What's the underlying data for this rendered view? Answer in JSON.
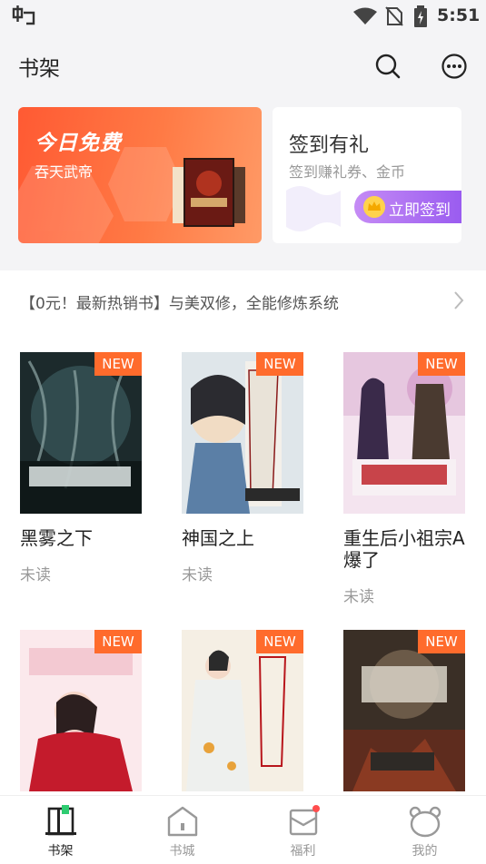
{
  "status_bar": {
    "time": "5:51"
  },
  "header": {
    "title": "书架"
  },
  "promo_free": {
    "label": "今日免费",
    "book": "吞天武帝"
  },
  "promo_sign": {
    "title": "签到有礼",
    "subtitle": "签到赚礼券、金币",
    "button": "立即签到"
  },
  "banner": {
    "text": "【0元！最新热销书】与美双修，全能修炼系统"
  },
  "books": [
    {
      "title": "黑雾之下",
      "status": "未读",
      "badge": "NEW"
    },
    {
      "title": "神国之上",
      "status": "未读",
      "badge": "NEW"
    },
    {
      "title": "重生后小祖宗A爆了",
      "status": "未读",
      "badge": "NEW"
    },
    {
      "title": "",
      "status": "",
      "badge": "NEW"
    },
    {
      "title": "",
      "status": "",
      "badge": "NEW"
    },
    {
      "title": "",
      "status": "",
      "badge": "NEW"
    }
  ],
  "bottom_nav": [
    {
      "label": "书架",
      "active": true,
      "icon": "bookshelf-icon"
    },
    {
      "label": "书城",
      "active": false,
      "icon": "store-icon"
    },
    {
      "label": "福利",
      "active": false,
      "icon": "gift-icon"
    },
    {
      "label": "我的",
      "active": false,
      "icon": "profile-icon"
    }
  ],
  "colors": {
    "accent": "#ff6b2c",
    "sign_button": "#9a5cf0",
    "active_nav": "#2ecc71"
  }
}
